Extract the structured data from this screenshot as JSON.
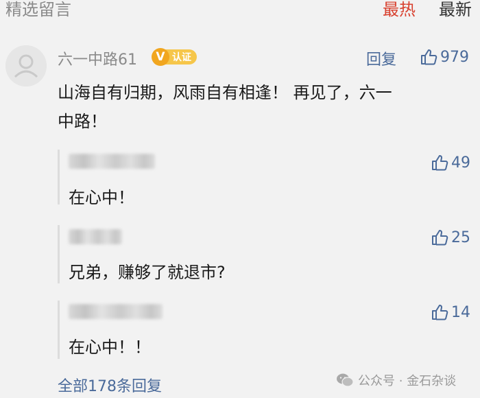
{
  "header": {
    "title": "精选留言",
    "sort_hot": "最热",
    "sort_new": "最新"
  },
  "colors": {
    "accent_red": "#d8412f",
    "link_blue": "#4a6a9a",
    "badge_gold": "#f1a61f"
  },
  "comment": {
    "author": "六一中路61",
    "badge_letter": "V",
    "badge_label": "认证",
    "reply_label": "回复",
    "likes": "979",
    "text_line1": "山海自有归期，风雨自有相逢！ 再见了，六一",
    "text_line2": "中路！",
    "avatar_icon": "default-user-avatar-icon",
    "like_icon": "thumbs-up-icon"
  },
  "replies": [
    {
      "text": "在心中！",
      "likes": "49"
    },
    {
      "text": "兄弟，赚够了就退市?",
      "likes": "25"
    },
    {
      "text": "在心中！！",
      "likes": "14"
    }
  ],
  "footer": {
    "all_replies": "全部178条回复",
    "watermark": "公众号 · 金石杂谈",
    "watermark_icon": "wechat-icon"
  }
}
